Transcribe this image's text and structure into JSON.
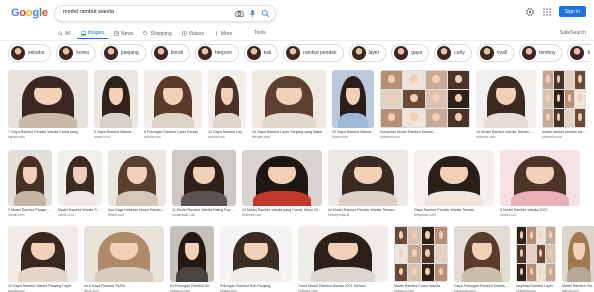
{
  "header": {
    "logo_letters": [
      {
        "ch": "G",
        "color": "#4285f4"
      },
      {
        "ch": "o",
        "color": "#ea4335"
      },
      {
        "ch": "o",
        "color": "#fbbc05"
      },
      {
        "ch": "g",
        "color": "#4285f4"
      },
      {
        "ch": "l",
        "color": "#34a853"
      },
      {
        "ch": "e",
        "color": "#ea4335"
      }
    ],
    "search_query": "model rambut wanita",
    "signin_label": "Sign in"
  },
  "tabs": [
    {
      "label": "All",
      "icon": "search-icon",
      "active": false
    },
    {
      "label": "Images",
      "icon": "image-icon",
      "active": true
    },
    {
      "label": "News",
      "icon": "news-icon",
      "active": false
    },
    {
      "label": "Shopping",
      "icon": "tag-icon",
      "active": false
    },
    {
      "label": "Videos",
      "icon": "play-icon",
      "active": false
    },
    {
      "label": "More",
      "icon": "dots-icon",
      "active": false
    }
  ],
  "tools_label": "Tools",
  "safesearch_label": "SafeSearch",
  "chips": [
    {
      "label": "sebahu"
    },
    {
      "label": "korea"
    },
    {
      "label": "panjang"
    },
    {
      "label": "bondi"
    },
    {
      "label": "berponi"
    },
    {
      "label": "kaii"
    },
    {
      "label": "rambut pendek"
    },
    {
      "label": "layer"
    },
    {
      "label": "gaya"
    },
    {
      "label": "curly"
    },
    {
      "label": "ovall"
    },
    {
      "label": "tomboy"
    },
    {
      "label": "bob"
    },
    {
      "label": "wajah"
    }
  ],
  "rows": [
    [
      {
        "caption": "7 Gaya Rambut Pendek Wanita Korea yang",
        "source": "zapata.com",
        "hair": "#3a2820",
        "top": "#c9b8a8",
        "bg": "#e8e2dc"
      },
      {
        "caption": "9 Gaya Rambut Wanita Sebahu",
        "source": "orami.co.id",
        "hair": "#2e221c",
        "top": "#d8d2cc",
        "bg": "#eae7e3"
      },
      {
        "caption": "8 Potongan Rambut Layer Panjang...",
        "source": "wanita.com",
        "hair": "#5a3a28",
        "top": "#ded4c8",
        "bg": "#f2ede6"
      },
      {
        "caption": "12 Gaya Rambut Layer Pendek...",
        "source": "wanita.com",
        "hair": "#4a3024",
        "top": "#e0d6cc",
        "bg": "#f3eee8"
      },
      {
        "caption": "20 Gaya Rambut Layer Panjang yang Wajib",
        "source": "lifestyle.com",
        "hair": "#5e4030",
        "top": "#e2d8ce",
        "bg": "#efe9e2"
      },
      {
        "caption": "30 Gaya Rambut Wanita",
        "source": "fimela.com",
        "hair": "#2a1c16",
        "top": "#9fb7d6",
        "bg": "#b9c8dc"
      },
      {
        "caption": "Kumpulan Model Rambut Wanita...",
        "source": "pinterest.com",
        "collage": true
      },
      {
        "caption": "10 Model Rambut Wanita Terbaru 2021",
        "source": "idntimes.com",
        "hair": "#3c2a20",
        "top": "#e6ded6",
        "bg": "#f2f0ee"
      },
      {
        "caption": "model rambut pendek wanita",
        "source": "pinterest.com",
        "collage": true
      }
    ],
    [
      {
        "caption": "9 Model Rambut Panjang Terbaik",
        "source": "rumah.com",
        "hair": "#4a3024",
        "top": "#c4b4a4",
        "bg": "#e4ded8"
      },
      {
        "caption": "Model Rambut Wanita Shaggy",
        "source": "orami.co.id",
        "hair": "#3a2a22",
        "top": "#ece8e4",
        "bg": "#f4f2f0"
      },
      {
        "caption": "Ikut Gaya Kekinian Model Rambut Terbaru",
        "source": "fimela.com",
        "hair": "#5a3e2e",
        "top": "#d4c6b8",
        "bg": "#ece6e0"
      },
      {
        "caption": "11 Model Rambut Wanita Paling Populer",
        "source": "rumahsakit.com",
        "hair": "#2e2018",
        "top": "#5a5450",
        "bg": "#cfc8c2"
      },
      {
        "caption": "10 Model Rambut Wanita yang Cocok Tahun 2021",
        "source": "idntimes.com",
        "hair": "#1e1612",
        "top": "#c0392b",
        "bg": "#d9d4d0"
      },
      {
        "caption": "Ini Model Rambut Pendek Wanita Terbaru",
        "source": "beautynesia.id",
        "hair": "#3a2a22",
        "top": "#dcd2c8",
        "bg": "#ebe7e3"
      },
      {
        "caption": "Gaya Rambut Pendek Wanita Terbaik",
        "source": "kumparan.com",
        "hair": "#2a1e18",
        "top": "#eee6de",
        "bg": "#f5f1ed"
      },
      {
        "caption": "8 Model Rambut Wanita 2022",
        "source": "orami.co.id",
        "hair": "#4e3426",
        "top": "#e8b0b8",
        "bg": "#f4e2e4"
      }
    ],
    [
      {
        "caption": "12 Gaya Rambut Wanita Panjang Layer",
        "source": "wanita.com",
        "hair": "#3a2820",
        "top": "#e2d6cc",
        "bg": "#f0ebe6"
      },
      {
        "caption": "Ini 5 Gaya Rambut TikTok",
        "source": "tiktok.com",
        "hair": "#b08a68",
        "top": "#d8ccc0",
        "bg": "#e8e2da"
      },
      {
        "caption": "Ini Potongan Rambut Sebahu",
        "source": "pinterest.com",
        "hair": "#241a14",
        "top": "#4a4440",
        "bg": "#c6c0ba"
      },
      {
        "caption": "Potongan Rambut Bob Panjang",
        "source": "beauty.com",
        "hair": "#3c2c24",
        "top": "#f0ece8",
        "bg": "#f7f5f3"
      },
      {
        "caption": "Trend Model Rambut Wanita 2021 Terbaru",
        "source": "idntimes.com",
        "hair": "#2c201a",
        "top": "#ddd6d0",
        "bg": "#efebe7"
      },
      {
        "caption": "Model Rambut Korea Wanita",
        "source": "pinterest.com",
        "collage": true
      },
      {
        "caption": "Gaya Potongan Rambut Wanita Trendy",
        "source": "kumparan.com",
        "hair": "#5a3c2c",
        "top": "#cdbcaa",
        "bg": "#e2dbd3"
      },
      {
        "caption": "Inspirasi Rambut Layer",
        "source": "pinterest.com",
        "collage": true
      },
      {
        "caption": "Model Rambut Ombre",
        "source": "wanita.com",
        "hair": "#a0794f",
        "top": "#b7a894",
        "bg": "#dcd5cb"
      }
    ]
  ]
}
